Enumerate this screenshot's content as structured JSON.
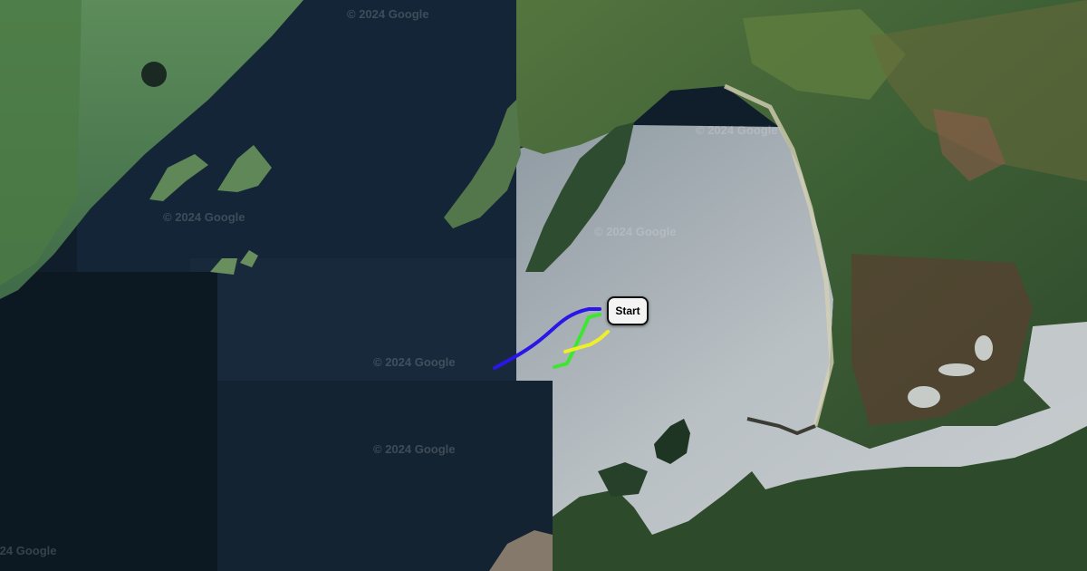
{
  "map": {
    "watermark": "© 2024 Google",
    "start_label": "Start",
    "colors": {
      "water_dark": "#0e1b28",
      "water_light": "#aab3b8",
      "land_green": "#3f6a3c",
      "track_blue": "#2a16e8",
      "track_green": "#3ee632",
      "track_yellow": "#f0ee2a"
    },
    "tracks": [
      {
        "color": "blue"
      },
      {
        "color": "green"
      },
      {
        "color": "yellow"
      }
    ]
  }
}
